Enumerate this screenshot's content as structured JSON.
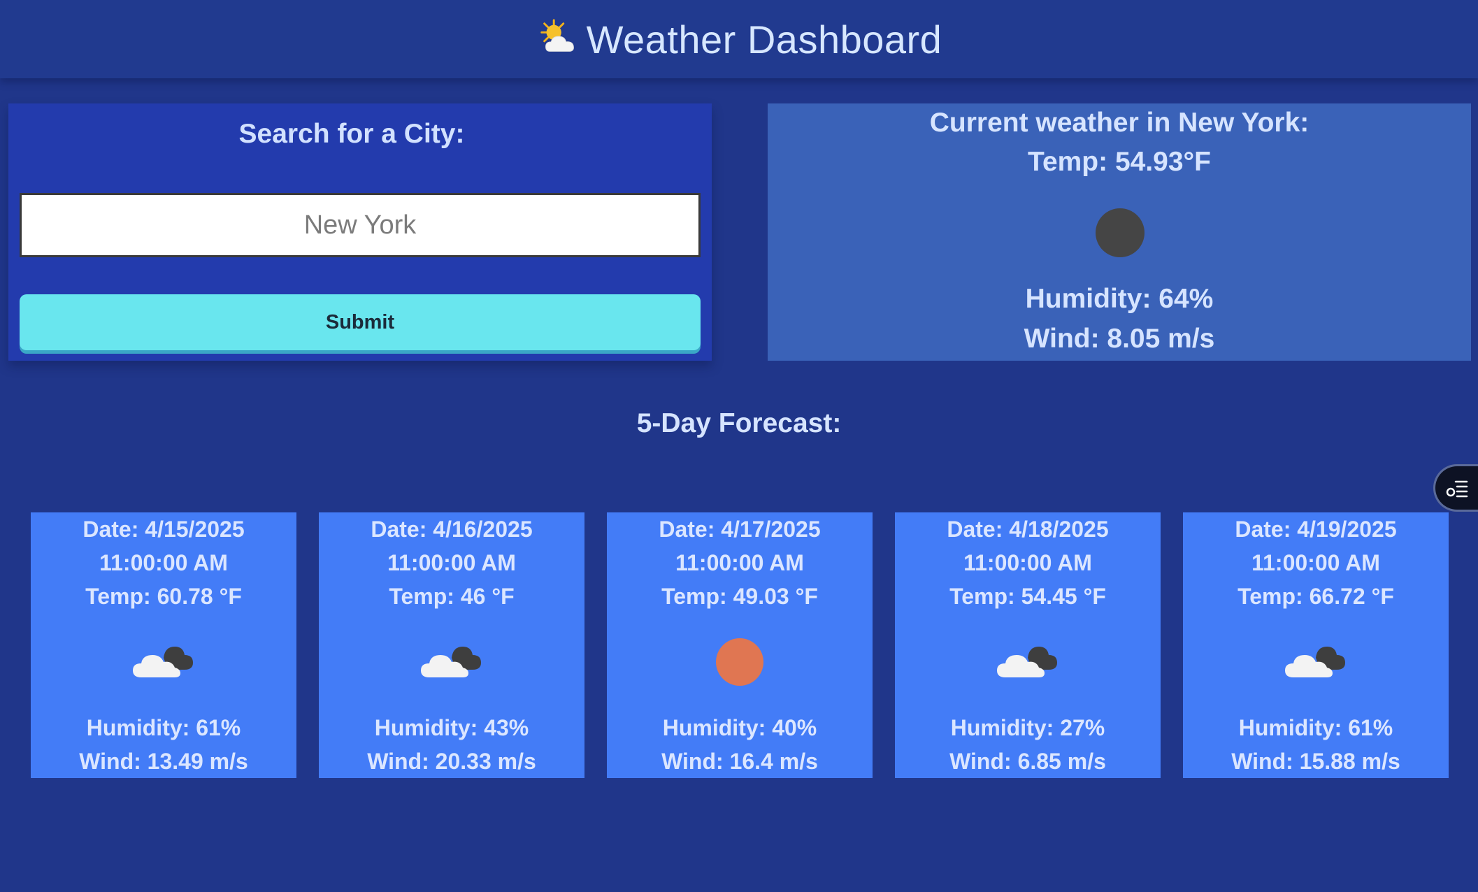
{
  "header": {
    "title": "Weather Dashboard",
    "icon": "sun-behind-cloud-icon"
  },
  "search": {
    "heading": "Search for a City:",
    "placeholder": "New York",
    "value": "",
    "submit_label": "Submit"
  },
  "current": {
    "heading": "Current weather in New York:",
    "temp": "Temp: 54.93°F",
    "icon": "dark-circle-weather-icon",
    "humidity": "Humidity: 64%",
    "wind": "Wind: 8.05 m/s"
  },
  "forecast": {
    "heading": "5-Day Forecast:",
    "days": [
      {
        "date": "Date: 4/15/2025",
        "time": "11:00:00 AM",
        "temp": "Temp: 60.78 °F",
        "icon": "cloud-icon",
        "humidity": "Humidity: 61%",
        "wind": "Wind: 13.49 m/s"
      },
      {
        "date": "Date: 4/16/2025",
        "time": "11:00:00 AM",
        "temp": "Temp: 46 °F",
        "icon": "cloud-icon",
        "humidity": "Humidity: 43%",
        "wind": "Wind: 20.33 m/s"
      },
      {
        "date": "Date: 4/17/2025",
        "time": "11:00:00 AM",
        "temp": "Temp: 49.03 °F",
        "icon": "sun-icon",
        "humidity": "Humidity: 40%",
        "wind": "Wind: 16.4 m/s"
      },
      {
        "date": "Date: 4/18/2025",
        "time": "11:00:00 AM",
        "temp": "Temp: 54.45 °F",
        "icon": "cloud-icon",
        "humidity": "Humidity: 27%",
        "wind": "Wind: 6.85 m/s"
      },
      {
        "date": "Date: 4/19/2025",
        "time": "11:00:00 AM",
        "temp": "Temp: 66.72 °F",
        "icon": "cloud-icon",
        "humidity": "Humidity: 61%",
        "wind": "Wind: 15.88 m/s"
      }
    ]
  },
  "side_widget": {
    "icon": "list-toggle-icon"
  },
  "colors": {
    "background": "#20368a",
    "search_panel": "#233bad",
    "current_panel": "#3a62b8",
    "forecast_card": "#437cf7",
    "submit_button": "#69e6ee",
    "text": "#d6e4ff"
  }
}
